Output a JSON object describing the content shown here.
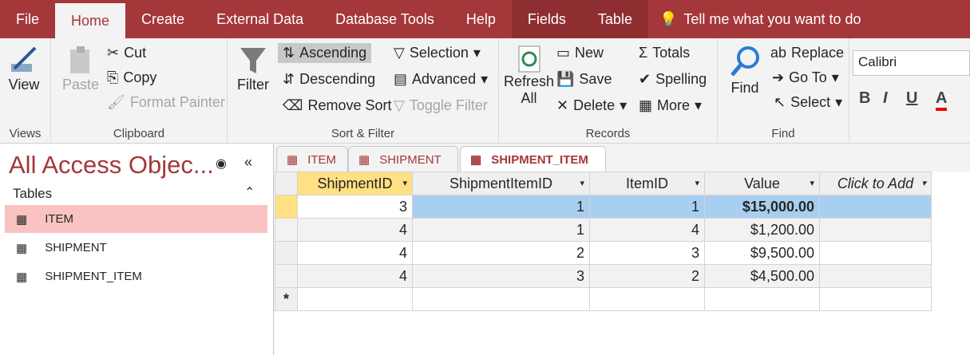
{
  "tabs": [
    "File",
    "Home",
    "Create",
    "External Data",
    "Database Tools",
    "Help",
    "Fields",
    "Table"
  ],
  "tell_me": "Tell me what you want to do",
  "ribbon": {
    "views": {
      "view": "View",
      "group": "Views"
    },
    "clipboard": {
      "paste": "Paste",
      "cut": "Cut",
      "copy": "Copy",
      "format_painter": "Format Painter",
      "group": "Clipboard"
    },
    "sort_filter": {
      "filter": "Filter",
      "ascending": "Ascending",
      "descending": "Descending",
      "remove_sort": "Remove Sort",
      "selection": "Selection",
      "advanced": "Advanced",
      "toggle_filter": "Toggle Filter",
      "group": "Sort & Filter"
    },
    "records": {
      "refresh": "Refresh",
      "refresh_all": "All",
      "new": "New",
      "save": "Save",
      "delete": "Delete",
      "totals": "Totals",
      "spelling": "Spelling",
      "more": "More",
      "group": "Records"
    },
    "find": {
      "find": "Find",
      "replace": "Replace",
      "go_to": "Go To",
      "select": "Select",
      "group": "Find"
    },
    "font": {
      "name": "Calibri",
      "bold": "B",
      "italic": "I",
      "underline": "U",
      "color": "A"
    }
  },
  "nav": {
    "title": "All Access Objec...",
    "section": "Tables",
    "items": [
      "ITEM",
      "SHIPMENT",
      "SHIPMENT_ITEM"
    ]
  },
  "doc_tabs": [
    "ITEM",
    "SHIPMENT",
    "SHIPMENT_ITEM"
  ],
  "table": {
    "columns": [
      "ShipmentID",
      "ShipmentItemID",
      "ItemID",
      "Value",
      "Click to Add"
    ],
    "rows": [
      [
        "3",
        "1",
        "1",
        "$15,000.00"
      ],
      [
        "4",
        "1",
        "4",
        "$1,200.00"
      ],
      [
        "4",
        "2",
        "3",
        "$9,500.00"
      ],
      [
        "4",
        "3",
        "2",
        "$4,500.00"
      ]
    ],
    "new_row_marker": "*"
  }
}
